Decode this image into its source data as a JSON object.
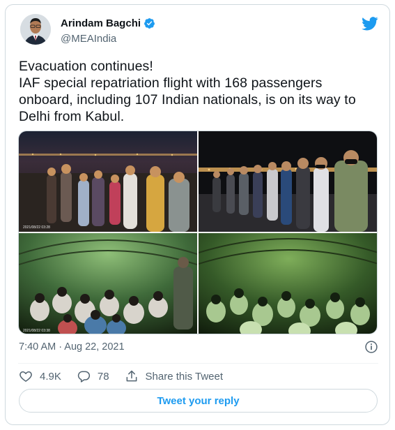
{
  "author": {
    "display_name": "Arindam Bagchi",
    "handle": "@MEAIndia",
    "verified": true
  },
  "tweet": {
    "lines": [
      "Evacuation continues!",
      "IAF special repatriation flight with 168 passengers",
      "onboard, including 107 Indian nationals, is on its way to",
      "Delhi from Kabul."
    ],
    "timestamp": "7:40 AM · Aug 22, 2021"
  },
  "media": {
    "photos": [
      {
        "name": "photo-tarmac-crowd",
        "caption": "2021/08/22 03:28"
      },
      {
        "name": "photo-tarmac-line",
        "caption": ""
      },
      {
        "name": "photo-aircraft-interior-1",
        "caption": "2021/08/22 03:38"
      },
      {
        "name": "photo-aircraft-interior-2",
        "caption": ""
      }
    ]
  },
  "actions": {
    "likes": "4.9K",
    "replies": "78",
    "share_label": "Share this Tweet"
  },
  "reply_button_label": "Tweet your reply",
  "colors": {
    "accent": "#1d9bf0",
    "secondary_text": "#536471",
    "border": "#cfd9de"
  },
  "icons": [
    "verified-badge-icon",
    "twitter-bird-icon",
    "info-icon",
    "heart-icon",
    "reply-bubble-icon",
    "share-icon"
  ]
}
